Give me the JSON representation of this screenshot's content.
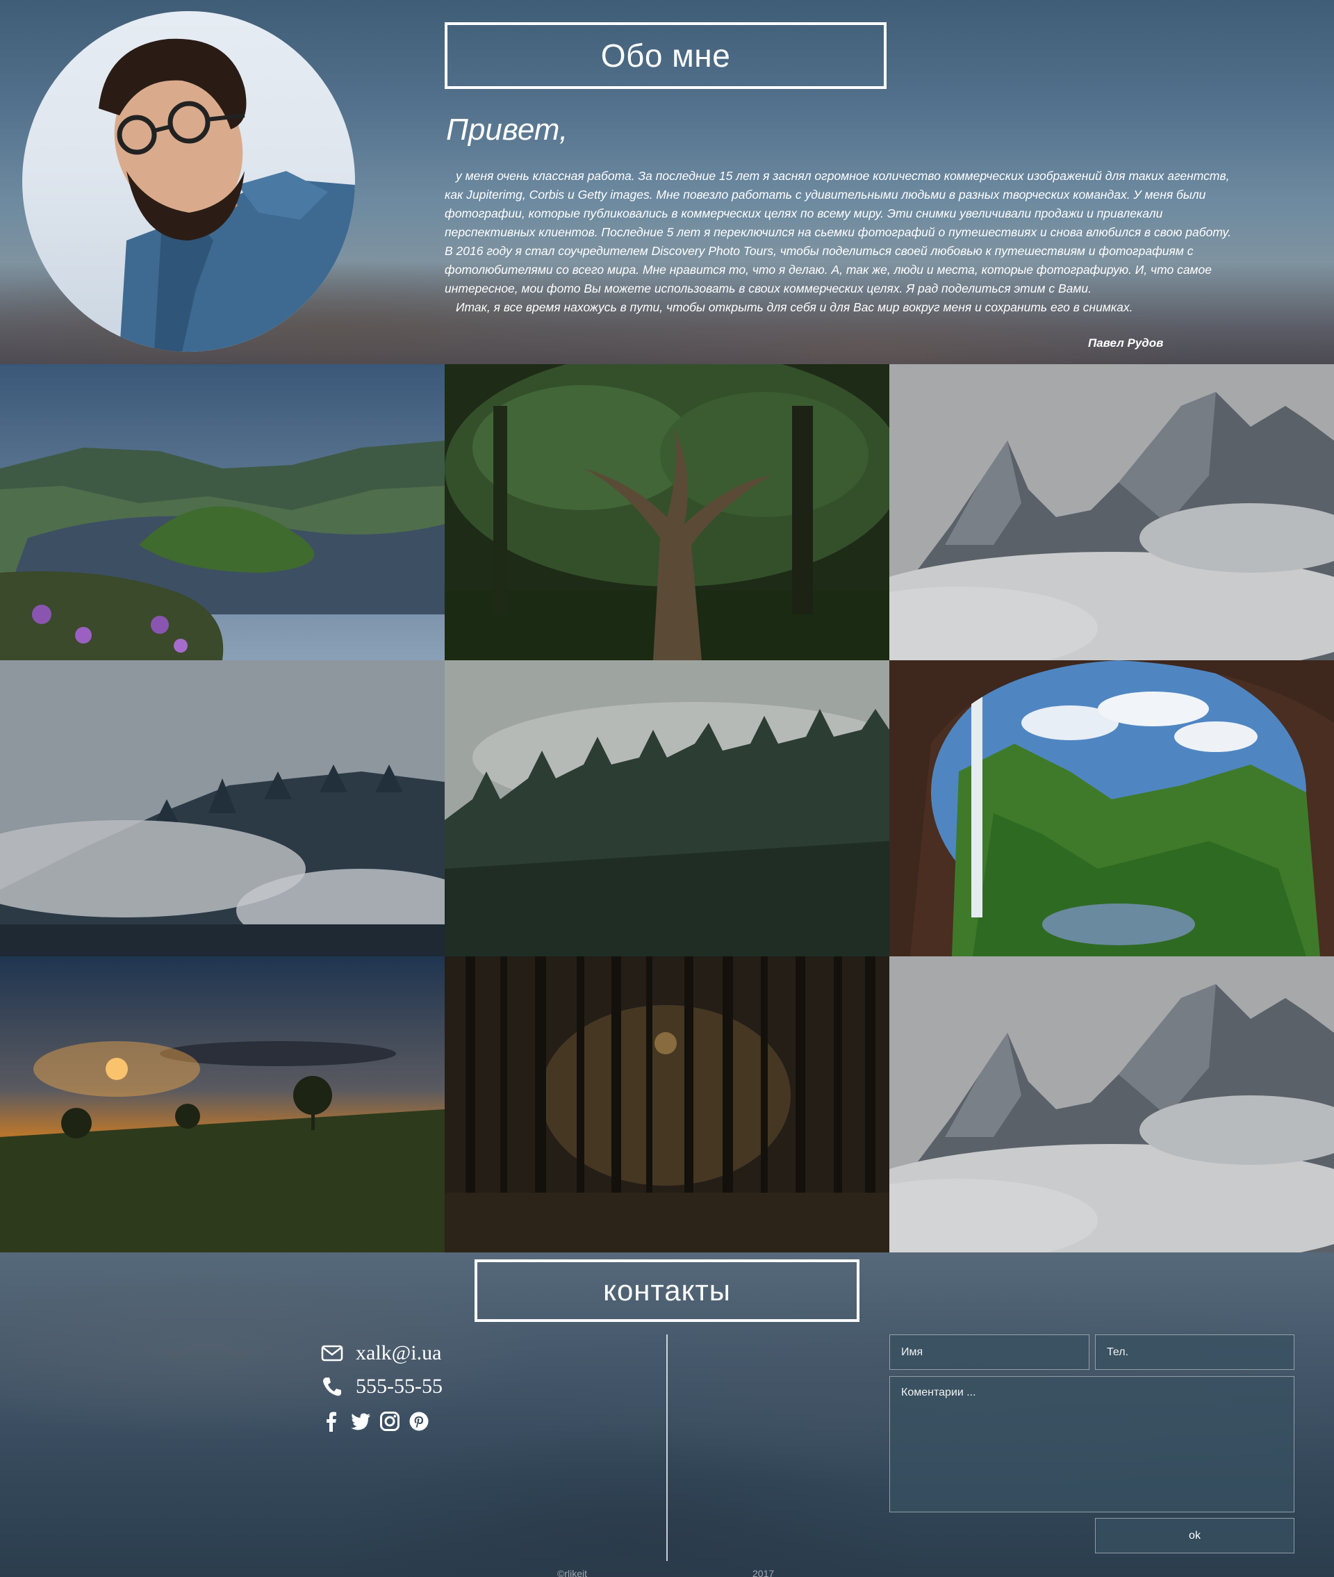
{
  "about": {
    "title": "Обо мне",
    "greeting": "Привет,",
    "paragraphs": [
      "у меня очень классная работа. За последние 15 лет я заснял огромное количество коммерческих изображений для таких агентств, как Jupiterimg, Corbis и Getty images. Мне повезло работать с удивительными людьми в разных творческих командах. У меня были фотографии, которые публиковались в коммерческих целях по всему миру. Эти снимки увеличивали продажи и привлекали перспективных клиентов. Последние 5 лет я переключился на сьемки фотографий о путешествиях и снова влюбился в свою работу. В 2016 году я стал соучредителем Discovery Photo Tours, чтобы поделиться своей любовью к путешествиям и фотографиям с фотолюбителями со всего мира. Мне нравится то, что я делаю. А, так же, люди и места, которые фотографирую. И, что самое интересное, мои фото Вы можете использовать в своих коммерческих целях. Я рад поделиться этим с Вами.",
      "Итак, я все время нахожусь в пути, чтобы открыть для себя и для Вас мир вокруг меня и сохранить его в снимках."
    ],
    "signature": "Павел Рудов"
  },
  "gallery": {
    "tiles": [
      {
        "name": "lake-meander-photo",
        "scene": "lake"
      },
      {
        "name": "old-tree-forest-photo",
        "scene": "tree"
      },
      {
        "name": "misty-mountains-photo",
        "scene": "mountain"
      },
      {
        "name": "foggy-pine-hill-photo",
        "scene": "fogpines"
      },
      {
        "name": "misty-forest-photo",
        "scene": "mistforest"
      },
      {
        "name": "cave-waterfall-photo",
        "scene": "waterfall"
      },
      {
        "name": "sunset-meadow-photo",
        "scene": "sunset"
      },
      {
        "name": "dark-forest-sunbeam-photo",
        "scene": "darkforest"
      },
      {
        "name": "misty-mountains-photo-2",
        "scene": "mountain"
      }
    ]
  },
  "contacts": {
    "title": "контакты",
    "email": "xalk@i.ua",
    "phone": "555-55-55",
    "email_icon": "envelope-icon",
    "phone_icon": "phone-icon",
    "social_icons": [
      "facebook-icon",
      "twitter-icon",
      "instagram-icon",
      "pinterest-icon"
    ],
    "form": {
      "name_placeholder": "Имя",
      "phone_placeholder": "Тел.",
      "comment_placeholder": "Коментарии ...",
      "submit_label": "ok"
    },
    "footer_left": "©rlikeit",
    "footer_right": "2017"
  }
}
